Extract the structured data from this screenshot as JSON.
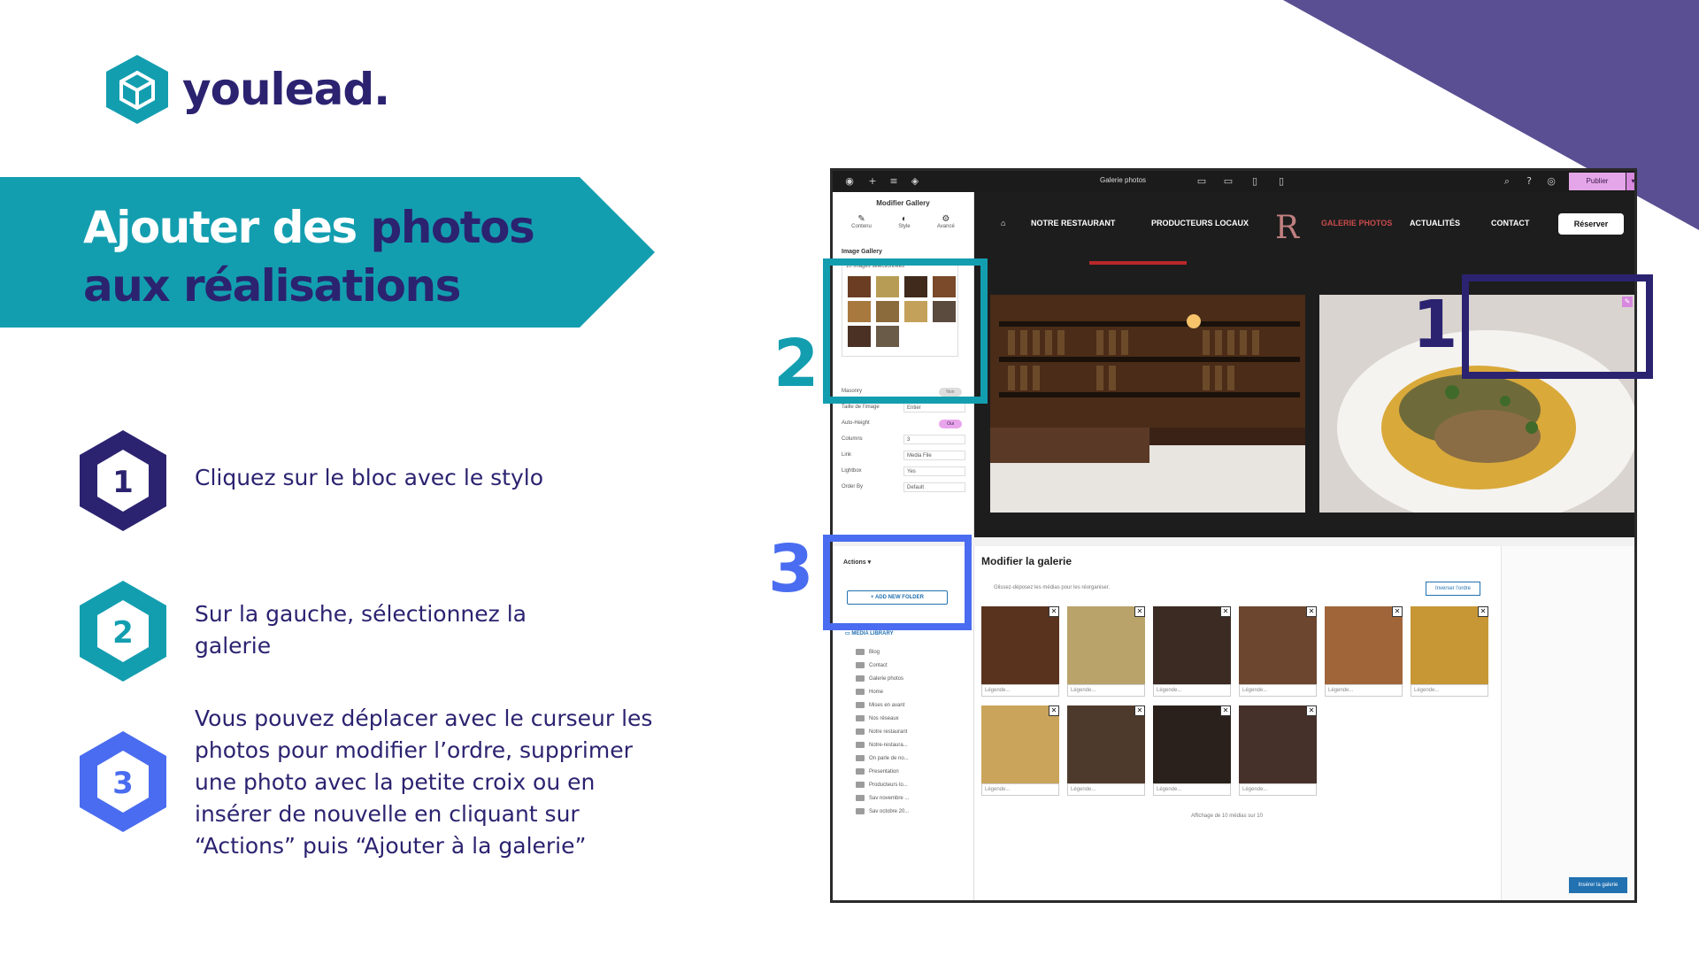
{
  "brand": {
    "name": "youlead.",
    "accent": "#139eb0",
    "navy": "#2b2370",
    "purple": "#5a4f93",
    "blue": "#4a6cf0"
  },
  "banner": {
    "title_part1": "Ajouter des ",
    "title_highlight": "photos",
    "title_part2": "aux réalisations"
  },
  "steps": [
    {
      "num": "1",
      "text": "Cliquez sur le bloc avec le stylo",
      "color": "#2b2370"
    },
    {
      "num": "2",
      "text": "Sur la gauche, sélectionnez la galerie",
      "color": "#139eb0"
    },
    {
      "num": "3",
      "text": "Vous pouvez déplacer avec le curseur les photos pour modifier l’ordre, supprimer une photo avec la petite croix ou en insérer de nouvelle en cliquant sur “Actions” puis “Ajouter à la galerie”",
      "color": "#4a6cf0"
    }
  ],
  "annotations": {
    "one": "1",
    "two": "2",
    "three": "3"
  },
  "editor": {
    "page_title": "Galerie photos",
    "publish_label": "Publier",
    "panel_title": "Modifier Gallery",
    "tabs": [
      "Contenu",
      "Style",
      "Avancé"
    ],
    "section": "Image Gallery",
    "selected_count": "10 images sélectionnées",
    "settings": [
      {
        "label": "Masonry",
        "value": "Non",
        "kind": "toggle"
      },
      {
        "label": "Taille de l’image",
        "value": "Entier",
        "kind": "select"
      },
      {
        "label": "Auto-Height",
        "value": "Oui",
        "kind": "toggle-on"
      },
      {
        "label": "Columns",
        "value": "3",
        "kind": "select"
      },
      {
        "label": "Link",
        "value": "Media File",
        "kind": "select"
      },
      {
        "label": "Lightbox",
        "value": "Yes",
        "kind": "select"
      },
      {
        "label": "Order By",
        "value": "Default",
        "kind": "select"
      }
    ]
  },
  "site_nav": {
    "items": [
      "NOTRE RESTAURANT",
      "PRODUCTEURS LOCAUX",
      "GALERIE PHOTOS",
      "ACTUALITÉS",
      "CONTACT"
    ],
    "cta": "Réserver"
  },
  "modal": {
    "title": "Modifier la galerie",
    "hint": "Glissez-déposez les médias pour les réorganiser.",
    "reverse_label": "Inverser l’ordre",
    "caption_placeholder": "Légende...",
    "count_text": "Affichage de 10 médias sur 10",
    "insert_label": "Insérer la galerie"
  },
  "library": {
    "actions_label": "Actions",
    "add_folder_label": "ADD NEW FOLDER",
    "head_label": "MEDIA LIBRARY",
    "folders": [
      "Blog",
      "Contact",
      "Galerie photos",
      "Home",
      "Mises en avant",
      "Nos réseaux",
      "Notre restaurant",
      "Notre-restaura...",
      "On parle de no...",
      "Presentation",
      "Producteurs lo...",
      "Sav novembre ...",
      "Sav octobre 20..."
    ]
  }
}
